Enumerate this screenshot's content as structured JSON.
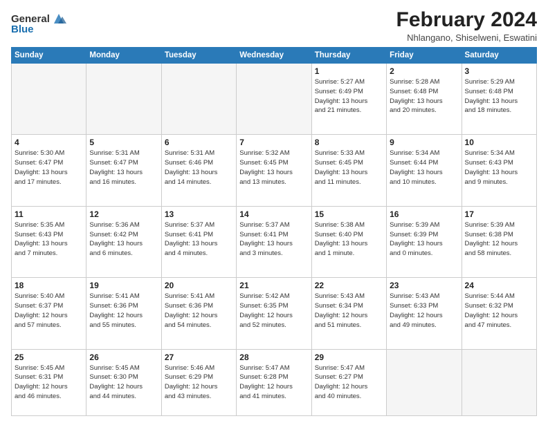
{
  "header": {
    "logo_general": "General",
    "logo_blue": "Blue",
    "title": "February 2024",
    "subtitle": "Nhlangano, Shiselweni, Eswatini"
  },
  "days_of_week": [
    "Sunday",
    "Monday",
    "Tuesday",
    "Wednesday",
    "Thursday",
    "Friday",
    "Saturday"
  ],
  "weeks": [
    [
      {
        "day": "",
        "info": ""
      },
      {
        "day": "",
        "info": ""
      },
      {
        "day": "",
        "info": ""
      },
      {
        "day": "",
        "info": ""
      },
      {
        "day": "1",
        "info": "Sunrise: 5:27 AM\nSunset: 6:49 PM\nDaylight: 13 hours\nand 21 minutes."
      },
      {
        "day": "2",
        "info": "Sunrise: 5:28 AM\nSunset: 6:48 PM\nDaylight: 13 hours\nand 20 minutes."
      },
      {
        "day": "3",
        "info": "Sunrise: 5:29 AM\nSunset: 6:48 PM\nDaylight: 13 hours\nand 18 minutes."
      }
    ],
    [
      {
        "day": "4",
        "info": "Sunrise: 5:30 AM\nSunset: 6:47 PM\nDaylight: 13 hours\nand 17 minutes."
      },
      {
        "day": "5",
        "info": "Sunrise: 5:31 AM\nSunset: 6:47 PM\nDaylight: 13 hours\nand 16 minutes."
      },
      {
        "day": "6",
        "info": "Sunrise: 5:31 AM\nSunset: 6:46 PM\nDaylight: 13 hours\nand 14 minutes."
      },
      {
        "day": "7",
        "info": "Sunrise: 5:32 AM\nSunset: 6:45 PM\nDaylight: 13 hours\nand 13 minutes."
      },
      {
        "day": "8",
        "info": "Sunrise: 5:33 AM\nSunset: 6:45 PM\nDaylight: 13 hours\nand 11 minutes."
      },
      {
        "day": "9",
        "info": "Sunrise: 5:34 AM\nSunset: 6:44 PM\nDaylight: 13 hours\nand 10 minutes."
      },
      {
        "day": "10",
        "info": "Sunrise: 5:34 AM\nSunset: 6:43 PM\nDaylight: 13 hours\nand 9 minutes."
      }
    ],
    [
      {
        "day": "11",
        "info": "Sunrise: 5:35 AM\nSunset: 6:43 PM\nDaylight: 13 hours\nand 7 minutes."
      },
      {
        "day": "12",
        "info": "Sunrise: 5:36 AM\nSunset: 6:42 PM\nDaylight: 13 hours\nand 6 minutes."
      },
      {
        "day": "13",
        "info": "Sunrise: 5:37 AM\nSunset: 6:41 PM\nDaylight: 13 hours\nand 4 minutes."
      },
      {
        "day": "14",
        "info": "Sunrise: 5:37 AM\nSunset: 6:41 PM\nDaylight: 13 hours\nand 3 minutes."
      },
      {
        "day": "15",
        "info": "Sunrise: 5:38 AM\nSunset: 6:40 PM\nDaylight: 13 hours\nand 1 minute."
      },
      {
        "day": "16",
        "info": "Sunrise: 5:39 AM\nSunset: 6:39 PM\nDaylight: 13 hours\nand 0 minutes."
      },
      {
        "day": "17",
        "info": "Sunrise: 5:39 AM\nSunset: 6:38 PM\nDaylight: 12 hours\nand 58 minutes."
      }
    ],
    [
      {
        "day": "18",
        "info": "Sunrise: 5:40 AM\nSunset: 6:37 PM\nDaylight: 12 hours\nand 57 minutes."
      },
      {
        "day": "19",
        "info": "Sunrise: 5:41 AM\nSunset: 6:36 PM\nDaylight: 12 hours\nand 55 minutes."
      },
      {
        "day": "20",
        "info": "Sunrise: 5:41 AM\nSunset: 6:36 PM\nDaylight: 12 hours\nand 54 minutes."
      },
      {
        "day": "21",
        "info": "Sunrise: 5:42 AM\nSunset: 6:35 PM\nDaylight: 12 hours\nand 52 minutes."
      },
      {
        "day": "22",
        "info": "Sunrise: 5:43 AM\nSunset: 6:34 PM\nDaylight: 12 hours\nand 51 minutes."
      },
      {
        "day": "23",
        "info": "Sunrise: 5:43 AM\nSunset: 6:33 PM\nDaylight: 12 hours\nand 49 minutes."
      },
      {
        "day": "24",
        "info": "Sunrise: 5:44 AM\nSunset: 6:32 PM\nDaylight: 12 hours\nand 47 minutes."
      }
    ],
    [
      {
        "day": "25",
        "info": "Sunrise: 5:45 AM\nSunset: 6:31 PM\nDaylight: 12 hours\nand 46 minutes."
      },
      {
        "day": "26",
        "info": "Sunrise: 5:45 AM\nSunset: 6:30 PM\nDaylight: 12 hours\nand 44 minutes."
      },
      {
        "day": "27",
        "info": "Sunrise: 5:46 AM\nSunset: 6:29 PM\nDaylight: 12 hours\nand 43 minutes."
      },
      {
        "day": "28",
        "info": "Sunrise: 5:47 AM\nSunset: 6:28 PM\nDaylight: 12 hours\nand 41 minutes."
      },
      {
        "day": "29",
        "info": "Sunrise: 5:47 AM\nSunset: 6:27 PM\nDaylight: 12 hours\nand 40 minutes."
      },
      {
        "day": "",
        "info": ""
      },
      {
        "day": "",
        "info": ""
      }
    ]
  ]
}
